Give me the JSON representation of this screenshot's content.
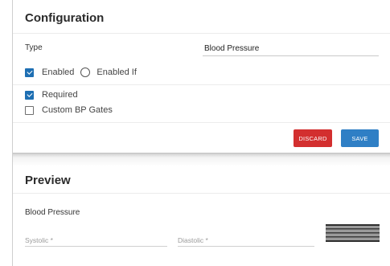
{
  "config": {
    "title": "Configuration",
    "type_label": "Type",
    "type_value": "Blood Pressure",
    "options": {
      "enabled": {
        "label": "Enabled",
        "checked": true
      },
      "enabled_if": {
        "label": "Enabled If",
        "selected": false
      },
      "required": {
        "label": "Required",
        "checked": true
      },
      "custom_bp_gates": {
        "label": "Custom BP Gates",
        "checked": false
      }
    },
    "buttons": {
      "discard_label": "DISCARD",
      "save_label": "SAVE"
    }
  },
  "preview": {
    "title": "Preview",
    "field_label": "Blood Pressure",
    "systolic_placeholder": "Systolic *",
    "diastolic_placeholder": "Diastolic *"
  },
  "colors": {
    "accent": "#1e6fb3",
    "discard": "#d32f2f",
    "save": "#2f7fc5"
  }
}
